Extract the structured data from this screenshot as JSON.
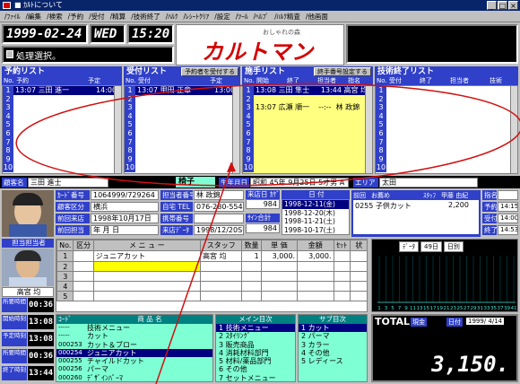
{
  "window": {
    "title": "■ ｶﾙﾄについて",
    "controls": [
      "_",
      "□",
      "×"
    ]
  },
  "menu": [
    "/ﾌｧｲﾙ",
    "/編集",
    "/検索",
    "/予約",
    "/受付",
    "/精算",
    "/技術終了",
    "/ﾊﾙｸ",
    "/ﾚｼｰﾄｸﾘｱ",
    "/設定",
    "/ﾂｰﾙ",
    "/ﾍﾙﾌﾟ",
    "/ﾊﾙｸ精査",
    "/他画面"
  ],
  "header": {
    "date": "1999-02-24",
    "weekday": "WED",
    "time": "15:20",
    "status": "処理選択。"
  },
  "logo": {
    "text": "カルトマン",
    "tagline": "おしゃれの森"
  },
  "reservation": {
    "title": "予約リスト",
    "cols": [
      "No.",
      "予約",
      "予定"
    ],
    "rows": [
      {
        "no": "1",
        "text": "13:07 三田 進一",
        "time": "14:00",
        "sel": true
      },
      {
        "no": "2"
      },
      {
        "no": "3"
      },
      {
        "no": "4"
      },
      {
        "no": "5"
      },
      {
        "no": "6"
      },
      {
        "no": "7"
      },
      {
        "no": "8"
      },
      {
        "no": "9"
      },
      {
        "no": "10"
      }
    ]
  },
  "reception": {
    "title": "受付リスト",
    "button": "予約者を受付する",
    "cols": [
      "No.",
      "受付",
      "予定"
    ],
    "rows": [
      {
        "no": "1",
        "text": "13:07 甲田 正章",
        "time": "13:00",
        "sel": true
      },
      {
        "no": "2"
      },
      {
        "no": "3"
      },
      {
        "no": "4"
      },
      {
        "no": "5"
      },
      {
        "no": "6"
      },
      {
        "no": "7"
      },
      {
        "no": "8"
      },
      {
        "no": "9"
      },
      {
        "no": "10"
      }
    ]
  },
  "treatment": {
    "title": "施手リスト",
    "button": "終手番号設定する",
    "cols": [
      "No.",
      "開始",
      "終了",
      "担当者",
      "指名"
    ],
    "rows": [
      {
        "no": "1",
        "text": "13:08 三田 隼士     13:44 高宮 均",
        "sel": true
      },
      {
        "no": "2"
      },
      {
        "no": "3",
        "text": "13:07 広瀬 順一    --:--  林 政錦"
      },
      {
        "no": "4"
      },
      {
        "no": "5"
      },
      {
        "no": "6"
      },
      {
        "no": "7"
      },
      {
        "no": "8"
      },
      {
        "no": "9"
      },
      {
        "no": "10"
      }
    ]
  },
  "finished": {
    "title": "技術終了リスト",
    "cols": [
      "No.",
      "受付",
      "終了",
      "担当者",
      "技術"
    ],
    "rows": [
      {
        "no": "1"
      },
      {
        "no": "2"
      },
      {
        "no": "3"
      },
      {
        "no": "4"
      },
      {
        "no": "5"
      },
      {
        "no": "6"
      },
      {
        "no": "7"
      },
      {
        "no": "8"
      },
      {
        "no": "9"
      },
      {
        "no": "10"
      }
    ]
  },
  "customer": {
    "name_label": "顧客名",
    "name": "三田 進士",
    "hdr1": "椅子",
    "hdr2": "生年月日",
    "birth": "昭和 45年 9月25日",
    "age": "5才",
    "sex": "男",
    "blood": "A",
    "field_label": "エリア",
    "area": "太田",
    "labels": [
      "ｶｰﾄﾞ番号",
      "顧客区分",
      "前回来店",
      "前回担当"
    ],
    "values": [
      "1064999/729264",
      "横浜",
      "1998年10月17日",
      "年 月 日"
    ],
    "labels2": [
      "担当者番号",
      "自宅 TEL",
      "携帯番号",
      "来店ﾃﾞｰﾀ"
    ],
    "values2": [
      "林 政錦",
      "076-280-5540",
      "",
      "1998/12/20SUN"
    ],
    "visit_label": "来店日 ｶｹﾞﾀ",
    "visit_val": "984",
    "visit_label2": "ｻｲﾝ合計",
    "visit_val2": "984"
  },
  "history": {
    "head": "日 付",
    "rows": [
      "1998-12-11(金)",
      "1998-12-20(木)",
      "1998-11-21(土)",
      "1998-10-17(土)"
    ]
  },
  "service_info": {
    "label1": "前回",
    "label2": "お薦め",
    "staff_label": "ｽﾀｯﾌ",
    "staff": "甲藤 由紀",
    "menu": "0255 子供カット",
    "price": "2,200",
    "side": [
      "指名",
      "予約",
      "受付",
      "終了"
    ],
    "sidevals": [
      "",
      "14:15",
      "14:00",
      "14:53"
    ]
  },
  "staff": {
    "title": "担当担当者",
    "name": "高宮 均",
    "times": [
      "00:36",
      "13:08",
      "13:08",
      "00:36",
      "13:44"
    ],
    "time_labels": [
      "所要時間",
      "開始時刻",
      "予定時刻",
      "所要時間",
      "終了時刻"
    ]
  },
  "order": {
    "cols": [
      "No.",
      "区分",
      "メ ニ ュ ー",
      "スタッフ",
      "数量",
      "単 価",
      "金額",
      "ｾｯﾄ",
      "状"
    ],
    "rows": [
      {
        "no": "1",
        "menu": "ジュニアカット",
        "staff": "高宮 均",
        "qty": "1",
        "price": "3,000.",
        "amount": "3,000."
      },
      {
        "no": "2"
      },
      {
        "no": "3"
      },
      {
        "no": "4"
      },
      {
        "no": "5"
      }
    ]
  },
  "chart": {
    "header": [
      "ﾃﾞｰﾀ",
      "49日",
      "日別"
    ],
    "x_labels": [
      "1",
      "3",
      "5",
      "7",
      "9",
      "11",
      "13",
      "15",
      "17",
      "19",
      "21",
      "23",
      "25",
      "27",
      "29",
      "31",
      "33",
      "35",
      "37",
      "39",
      "41"
    ]
  },
  "products": {
    "cols": [
      "ｺｰﾄﾞ",
      "商 品 名"
    ],
    "rows": [
      {
        "code": "-----",
        "name": "技術メニュー"
      },
      {
        "code": "-----",
        "name": "カット"
      },
      {
        "code": "000253",
        "name": "カット＆ブロー"
      },
      {
        "code": "000254",
        "name": "ジュニアカット",
        "sel": true
      },
      {
        "code": "000255",
        "name": "チャイルドカット"
      },
      {
        "code": "000256",
        "name": "パーマ"
      },
      {
        "code": "000260",
        "name": "ﾃﾞｻﾞｲﾝﾊﾟｰﾏ"
      }
    ]
  },
  "main_cat": {
    "title": "メイン目次",
    "rows": [
      {
        "t": "1 技術メニュー",
        "sel": true
      },
      {
        "t": "2 ｽﾀｲﾘﾝｸﾞ"
      },
      {
        "t": "3 販売商品"
      },
      {
        "t": "4 消耗材料部門"
      },
      {
        "t": "5 材料/薬品部門"
      },
      {
        "t": "6 その他"
      },
      {
        "t": "7 セットメニュー"
      }
    ]
  },
  "sub_cat": {
    "title": "サブ目次",
    "rows": [
      {
        "t": "1 カット",
        "sel": true
      },
      {
        "t": "2 パーマ"
      },
      {
        "t": "3 カラー"
      },
      {
        "t": "4 その他"
      },
      {
        "t": "5 レディース"
      }
    ]
  },
  "total": {
    "label": "TOTAL",
    "tag": "現金",
    "date_label": "日付",
    "date": "1999/ 4/14",
    "amount": "3,150."
  },
  "colors": {
    "lcd": "#000000",
    "panel_blue": "#3040c8",
    "teal": "#008080",
    "cyan": "#7fffd4",
    "yellow": "#ffff80",
    "annotation": "#d01010"
  }
}
